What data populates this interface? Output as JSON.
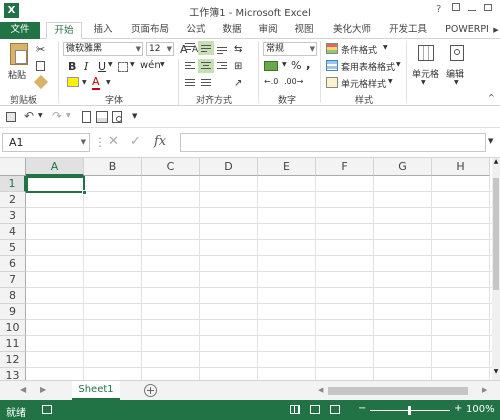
{
  "window": {
    "title": "工作簿1 - Microsoft Excel",
    "app_icon_letter": "X",
    "help_label": "?"
  },
  "ribbon_tabs": [
    {
      "label": "文件"
    },
    {
      "label": "开始"
    },
    {
      "label": "插入"
    },
    {
      "label": "页面布局"
    },
    {
      "label": "公式"
    },
    {
      "label": "数据"
    },
    {
      "label": "审阅"
    },
    {
      "label": "视图"
    },
    {
      "label": "美化大师"
    },
    {
      "label": "开发工具"
    },
    {
      "label": "POWERPI"
    }
  ],
  "ribbon": {
    "clipboard": {
      "paste_label": "粘贴",
      "group_label": "剪贴板"
    },
    "font": {
      "font_name": "微软雅黑",
      "font_size": "12",
      "bold": "B",
      "italic": "I",
      "underline": "U",
      "grow": "A",
      "shrink": "A",
      "wen": "wén",
      "group_label": "字体"
    },
    "alignment": {
      "group_label": "对齐方式"
    },
    "number": {
      "format": "常规",
      "percent": "%",
      "comma": ",",
      "group_label": "数字"
    },
    "styles": {
      "conditional": "条件格式",
      "table_format": "套用表格格式",
      "cell_styles": "单元格样式",
      "group_label": "样式"
    },
    "cells": {
      "label": "单元格"
    },
    "editing": {
      "label": "编辑"
    }
  },
  "formula_bar": {
    "name_box": "A1",
    "fx": "fx",
    "cancel": "✕",
    "enter": "✓"
  },
  "grid": {
    "columns": [
      "A",
      "B",
      "C",
      "D",
      "E",
      "F",
      "G",
      "H"
    ],
    "rows": [
      "1",
      "2",
      "3",
      "4",
      "5",
      "6",
      "7",
      "8",
      "9",
      "10",
      "11",
      "12",
      "13"
    ],
    "active_cell": "A1"
  },
  "sheets": [
    {
      "name": "Sheet1"
    }
  ],
  "statusbar": {
    "ready": "就绪",
    "zoom": "100%"
  },
  "colors": {
    "accent": "#217346",
    "selection": "#107c41"
  }
}
